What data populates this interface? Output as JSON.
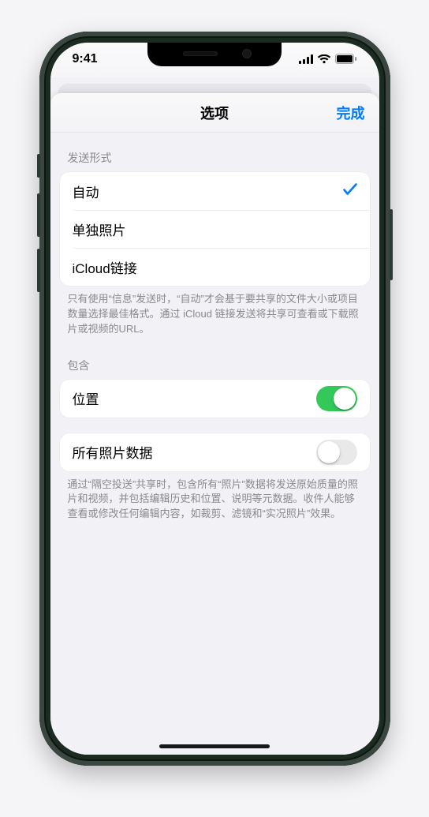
{
  "statusbar": {
    "time": "9:41"
  },
  "navbar": {
    "title": "选项",
    "done": "完成"
  },
  "sections": {
    "send_format": {
      "header": "发送形式",
      "options": {
        "auto": {
          "label": "自动",
          "selected": true
        },
        "single": {
          "label": "单独照片",
          "selected": false
        },
        "icloud": {
          "label": "iCloud链接",
          "selected": false
        }
      },
      "footer": "只有使用“信息”发送时，“自动”才会基于要共享的文件大小或项目数量选择最佳格式。通过 iCloud 链接发送将共享可查看或下载照片或视频的URL。"
    },
    "include": {
      "header": "包含",
      "location": {
        "label": "位置",
        "on": true
      }
    },
    "all_data": {
      "row": {
        "label": "所有照片数据",
        "on": false
      },
      "footer": "通过“隔空投送”共享时，包含所有“照片”数据将发送原始质量的照片和视频，并包括编辑历史和位置、说明等元数据。收件人能够查看或修改任何编辑内容，如裁剪、滤镜和“实况照片”效果。"
    }
  }
}
